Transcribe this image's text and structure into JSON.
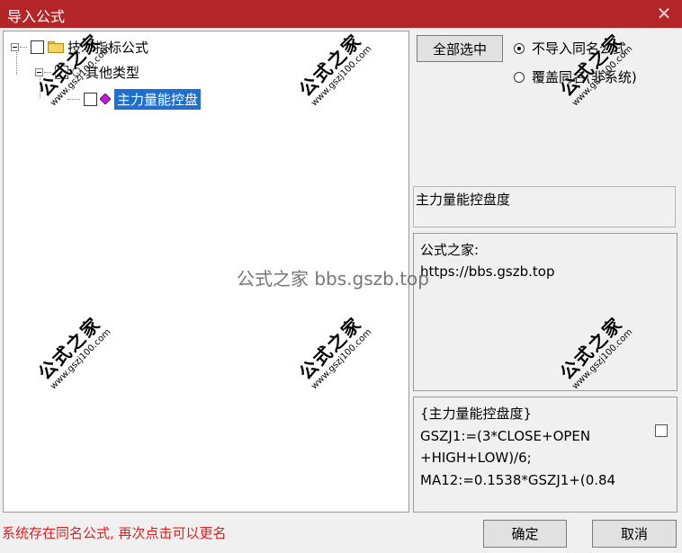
{
  "window": {
    "title": "导入公式",
    "close_glyph": "✕"
  },
  "tree": {
    "root_label": "技术指标公式",
    "child_label": "其他类型",
    "leaf_label": "主力量能控盘"
  },
  "options": {
    "select_all_label": "全部选中",
    "radio_skip_label": "不导入同名公式",
    "radio_overwrite_label": "覆盖同名(非系统)",
    "selected_option": "不导入同名公式"
  },
  "formula": {
    "name": "主力量能控盘度",
    "description_lines": [
      "公式之家:",
      "https://bbs.gszb.top"
    ],
    "code_lines": [
      "{主力量能控盘度}",
      "GSZJ1:=(3*CLOSE+OPEN",
      "+HIGH+LOW)/6;",
      "MA12:=0.1538*GSZJ1+(0.84"
    ]
  },
  "status_message": "系统存在同名公式, 再次点击可以更名",
  "buttons": {
    "ok_label": "确定",
    "cancel_label": "取消"
  },
  "watermark": {
    "center_text": "公式之家 bbs.gszb.top",
    "stamp_title": "公式之家",
    "stamp_url": "www.gszj100.com"
  },
  "colors": {
    "titlebar": "#b42528",
    "selection": "#1f6fd0",
    "status_text": "#e02020"
  }
}
